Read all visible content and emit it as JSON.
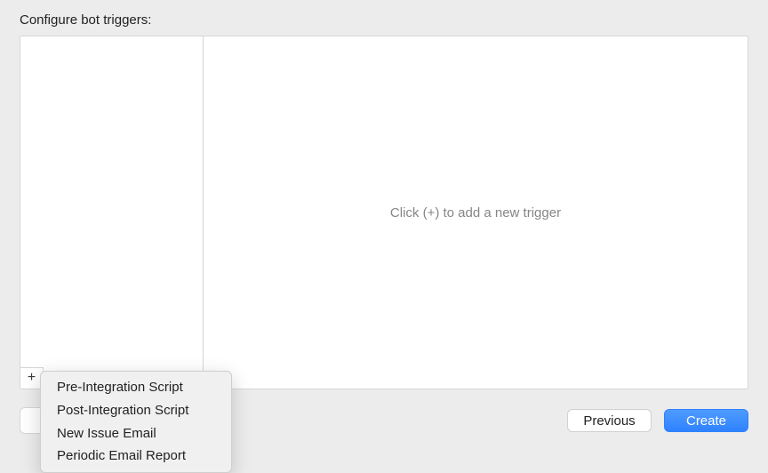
{
  "heading": "Configure bot triggers:",
  "placeholder": "Click (+) to add a new trigger",
  "addButtonGlyph": "+",
  "dropdown": {
    "items": [
      "Pre-Integration Script",
      "Post-Integration Script",
      "New Issue Email",
      "Periodic Email Report"
    ]
  },
  "buttons": {
    "previous": "Previous",
    "create": "Create"
  },
  "colors": {
    "primary": "#2f82ff",
    "background": "#ececec"
  }
}
